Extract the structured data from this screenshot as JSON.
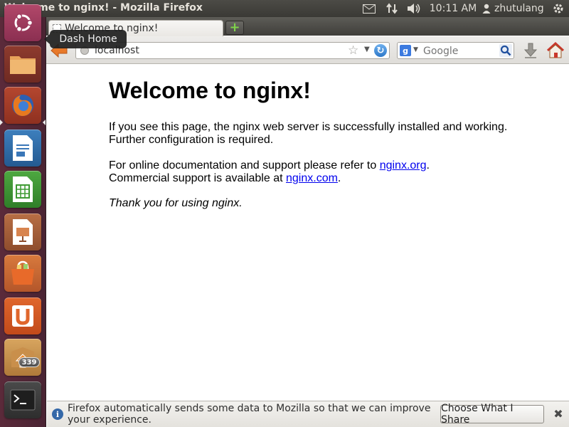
{
  "panel": {
    "window_title": "Welcome to nginx! - Mozilla Firefox",
    "clock": "10:11 AM",
    "username": "zhutulang"
  },
  "launcher": {
    "tooltip": "Dash Home",
    "items": [
      "Dash Home",
      "Files",
      "Firefox Web Browser",
      "LibreOffice Writer",
      "LibreOffice Calc",
      "LibreOffice Impress",
      "Ubuntu Software Center",
      "Ubuntu One",
      "Update Manager",
      "Terminal"
    ],
    "update_badge": "339"
  },
  "browser": {
    "tab_title": "Welcome to nginx!",
    "new_tab_label": "+",
    "url": "localhost",
    "search_placeholder": "Google",
    "search_engine_glyph": "g"
  },
  "page": {
    "heading": "Welcome to nginx!",
    "p1_line1": "If you see this page, the nginx web server is successfully installed and working.",
    "p1_line2": "Further configuration is required.",
    "p2_line1_prefix": "For online documentation and support please refer to ",
    "p2_link1": "nginx.org",
    "p2_line1_suffix": ".",
    "p2_line2_prefix": "Commercial support is available at ",
    "p2_link2": "nginx.com",
    "p2_line2_suffix": ".",
    "p3": "Thank you for using nginx."
  },
  "notification": {
    "text": "Firefox automatically sends some data to Mozilla so that we can improve your experience.",
    "button_label": "Choose What I Share",
    "close_glyph": "✖",
    "info_glyph": "i"
  },
  "colors": {
    "launcher_bg": "#5b2a3a",
    "panel_bg": "#3f3e3a",
    "link": "#0000ee"
  }
}
